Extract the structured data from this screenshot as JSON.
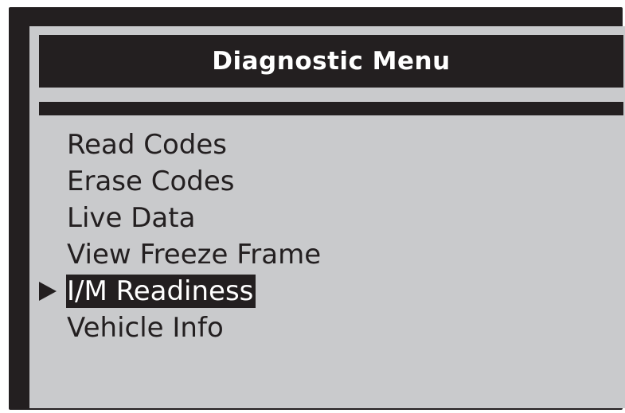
{
  "header": {
    "title": "Diagnostic Menu"
  },
  "menu": {
    "items": [
      {
        "label": "Read Codes",
        "selected": false
      },
      {
        "label": "Erase Codes",
        "selected": false
      },
      {
        "label": "Live Data",
        "selected": false
      },
      {
        "label": "View Freeze Frame",
        "selected": false
      },
      {
        "label": "I/M Readiness",
        "selected": true
      },
      {
        "label": "Vehicle Info",
        "selected": false
      }
    ],
    "cursor_icon": "triangle-right-icon"
  },
  "colors": {
    "frame": "#231f20",
    "screen": "#c9cacc",
    "title_text": "#ffffff",
    "highlight_bg": "#231f20",
    "highlight_text": "#ffffff"
  }
}
